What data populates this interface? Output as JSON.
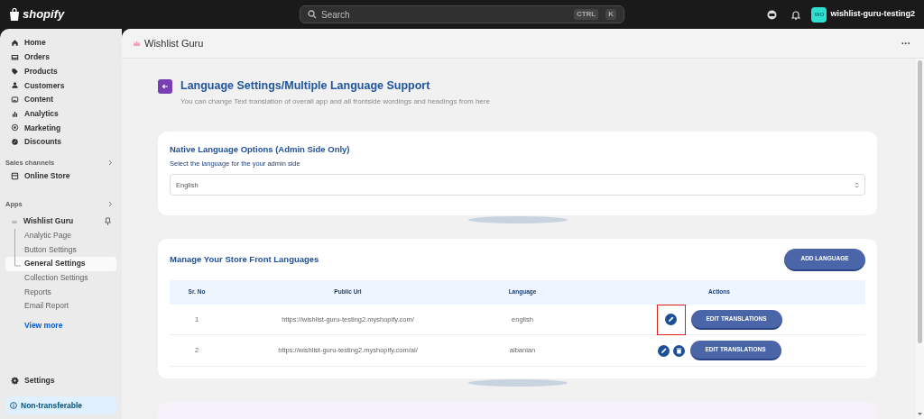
{
  "topbar": {
    "brand": "shopify",
    "search_placeholder": "Search",
    "shortcut": [
      "CTRL",
      "K"
    ],
    "store_initials": "wo",
    "store_name": "wishlist-guru-testing2"
  },
  "sidebar": {
    "nav": [
      {
        "label": "Home"
      },
      {
        "label": "Orders"
      },
      {
        "label": "Products"
      },
      {
        "label": "Customers"
      },
      {
        "label": "Content"
      },
      {
        "label": "Analytics"
      },
      {
        "label": "Marketing"
      },
      {
        "label": "Discounts"
      }
    ],
    "sales_channels": {
      "title": "Sales channels",
      "items": [
        {
          "label": "Online Store"
        }
      ]
    },
    "apps": {
      "title": "Apps",
      "app": "Wishlist Guru",
      "items": [
        {
          "label": "Analytic Page",
          "selected": false
        },
        {
          "label": "Button Settings",
          "selected": false
        },
        {
          "label": "General Settings",
          "selected": true
        },
        {
          "label": "Collection Settings",
          "selected": false
        },
        {
          "label": "Reports",
          "selected": false
        },
        {
          "label": "Email Report",
          "selected": false
        }
      ],
      "view_more": "View more"
    },
    "settings": "Settings",
    "notice": "Non-transferable"
  },
  "app_header": {
    "title": "Wishlist Guru",
    "more": "···"
  },
  "page": {
    "title": "Language Settings/Multiple Language Support",
    "subtitle": "You can change Text translation of overall app and all frontside wordings and headings from here"
  },
  "native_card": {
    "title": "Native Language Options (Admin Side Only)",
    "label": "Select the language for the your admin side",
    "value": "English"
  },
  "languages_card": {
    "title": "Manage Your Store Front Languages",
    "add_button": "ADD LANGUAGE",
    "table": {
      "columns": [
        "Sr. No",
        "Public Url",
        "Language",
        "Actions"
      ],
      "rows": [
        {
          "sr": "1",
          "url": "https://wishlist-guru-testing2.myshopify.com/",
          "language": "english",
          "deletable": false,
          "highlighted": true,
          "button": "EDIT TRANSLATIONS"
        },
        {
          "sr": "2",
          "url": "https://wishlist-guru-testing2.myshopify.com/al/",
          "language": "albanian",
          "deletable": true,
          "highlighted": false,
          "button": "EDIT TRANSLATIONS"
        }
      ]
    }
  }
}
